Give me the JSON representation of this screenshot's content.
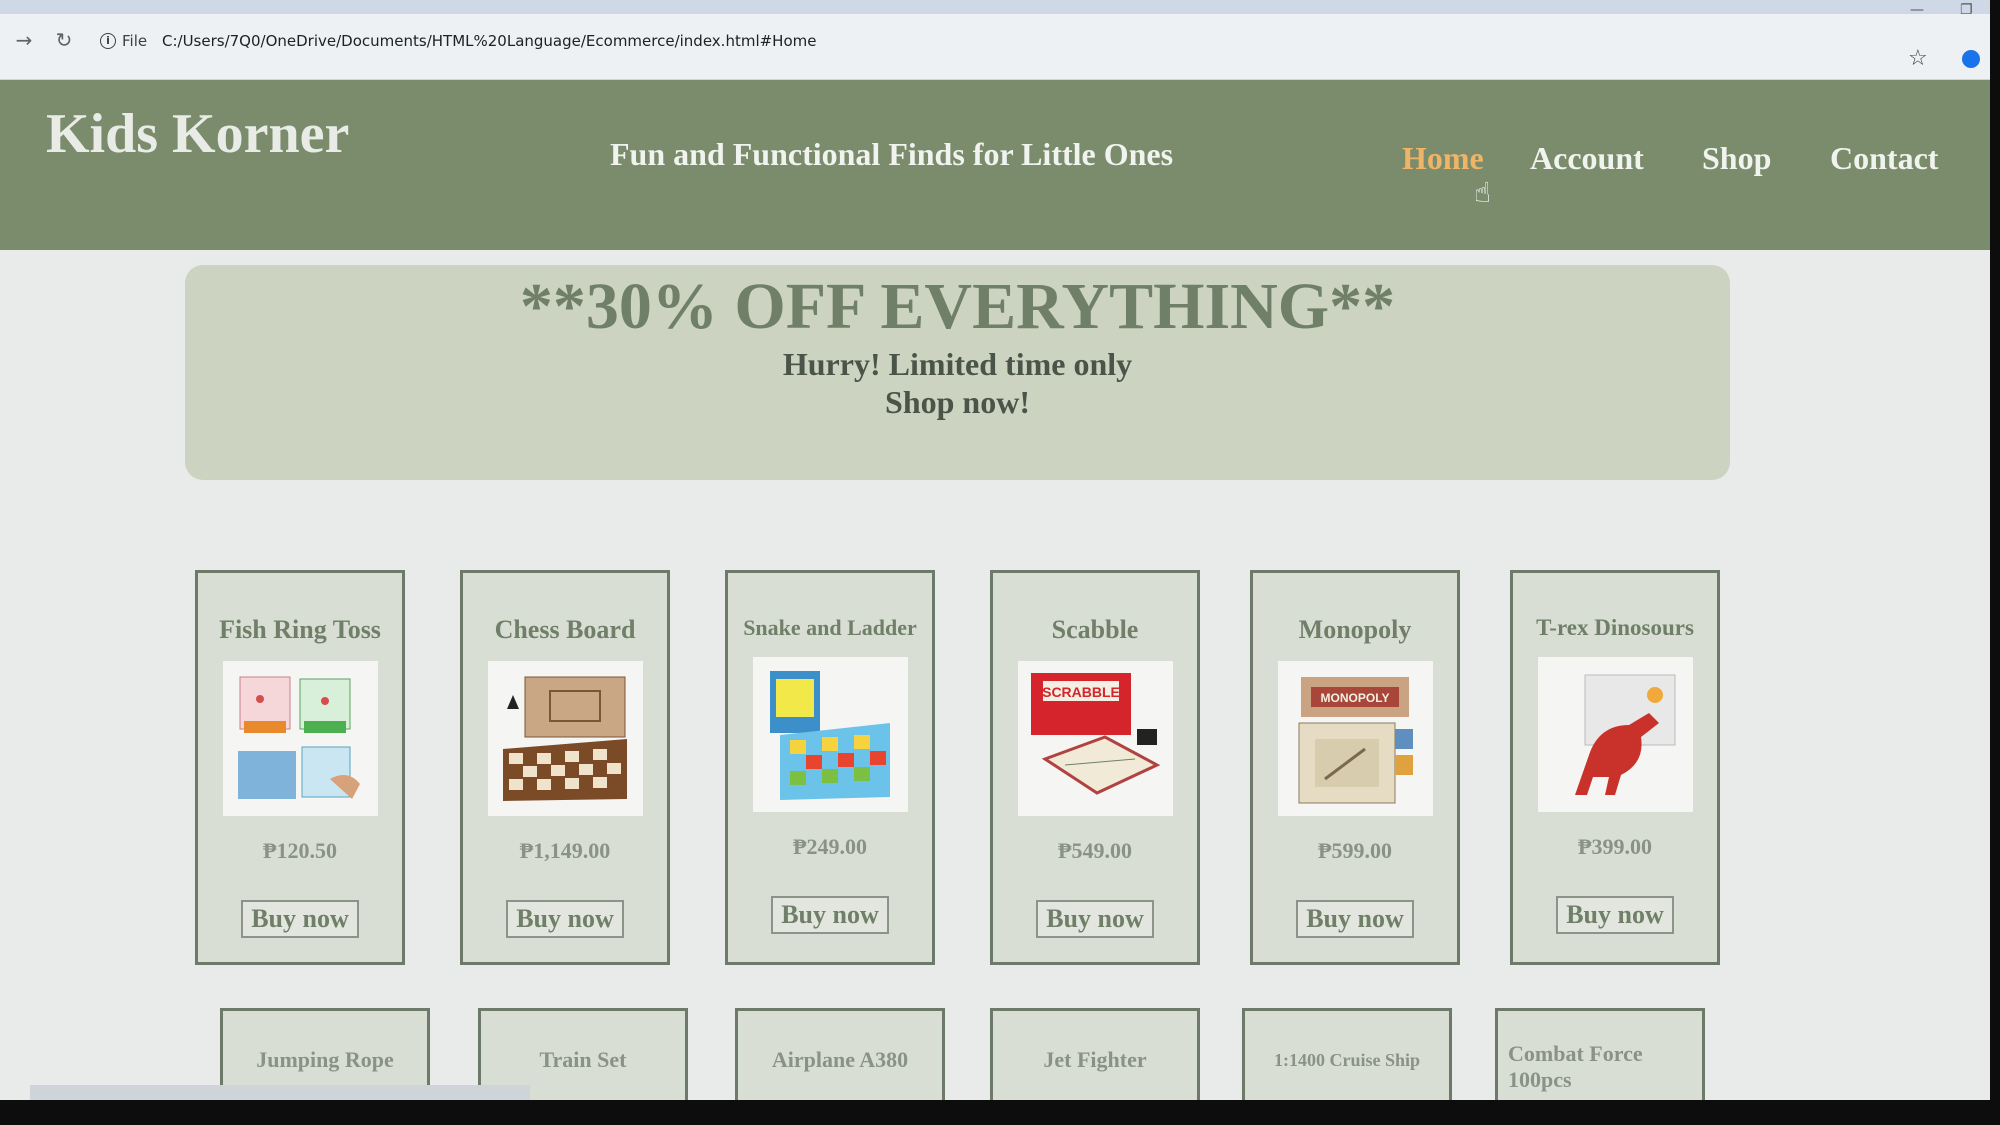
{
  "browser": {
    "file_label": "File",
    "url": "C:/Users/7Q0/OneDrive/Documents/HTML%20Language/Ecommerce/index.html#Home"
  },
  "site": {
    "brand": "Kids Korner",
    "tagline": "Fun and Functional Finds for Little Ones",
    "menu": [
      {
        "label": "Home",
        "active": true
      },
      {
        "label": "Account",
        "active": false
      },
      {
        "label": "Shop",
        "active": false
      },
      {
        "label": "Contact",
        "active": false
      }
    ]
  },
  "promo": {
    "title": "**30% OFF EVERYTHING**",
    "subtitle": "Hurry! Limited time only",
    "cta": "Shop now!"
  },
  "products": [
    {
      "name": "Fish Ring Toss",
      "price": "₱120.50",
      "button": "Buy now"
    },
    {
      "name": "Chess Board",
      "price": "₱1,149.00",
      "button": "Buy now"
    },
    {
      "name": "Snake and Ladder",
      "price": "₱249.00",
      "button": "Buy now"
    },
    {
      "name": "Scabble",
      "price": "₱549.00",
      "button": "Buy now"
    },
    {
      "name": "Monopoly",
      "price": "₱599.00",
      "button": "Buy now"
    },
    {
      "name": "T-rex Dinosours",
      "price": "₱399.00",
      "button": "Buy now"
    }
  ],
  "products_row2": [
    {
      "name": "Jumping Rope"
    },
    {
      "name": "Train Set"
    },
    {
      "name": "Airplane A380"
    },
    {
      "name": "Jet Fighter"
    },
    {
      "name": "1:1400 Cruise Ship"
    },
    {
      "name": "Combat Force 100pcs"
    }
  ],
  "colors": {
    "header": "#7a8c6c",
    "active_menu": "#f0b466",
    "promo_bg": "#cdd3c1",
    "card_border": "#6d7a6a"
  }
}
